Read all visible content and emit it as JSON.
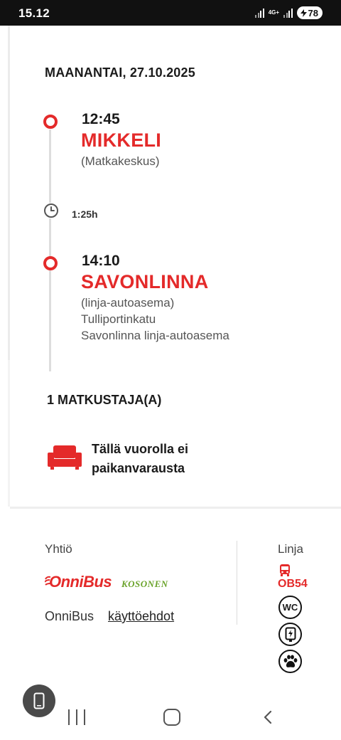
{
  "status_bar": {
    "time": "15.12",
    "network": "4G+",
    "battery": "78"
  },
  "trip": {
    "date": "MAANANTAI, 27.10.2025",
    "departure": {
      "time": "12:45",
      "city": "MIKKELI",
      "details": [
        "(Matkakeskus)"
      ]
    },
    "duration": "1:25h",
    "arrival": {
      "time": "14:10",
      "city": "SAVONLINNA",
      "details": [
        "(linja-autoasema)",
        "Tulliportinkatu",
        "Savonlinna linja-autoasema"
      ]
    },
    "passengers": "1 MATKUSTAJA(A)",
    "seat_info": "Tällä vuorolla ei paikanvarausta"
  },
  "operator": {
    "label": "Yhtiö",
    "logo_text": "OnniBus",
    "logo_subtext": "KOSONEN",
    "brand": "OnniBus",
    "terms_link": "käyttöehdot"
  },
  "line": {
    "label": "Linja",
    "code": "OB54",
    "amenities": [
      "wc-icon",
      "usb-charging-icon",
      "pets-allowed-icon"
    ],
    "wc_text": "WC"
  },
  "colors": {
    "accent": "#e42a2a",
    "logo_green": "#6aa32a"
  }
}
